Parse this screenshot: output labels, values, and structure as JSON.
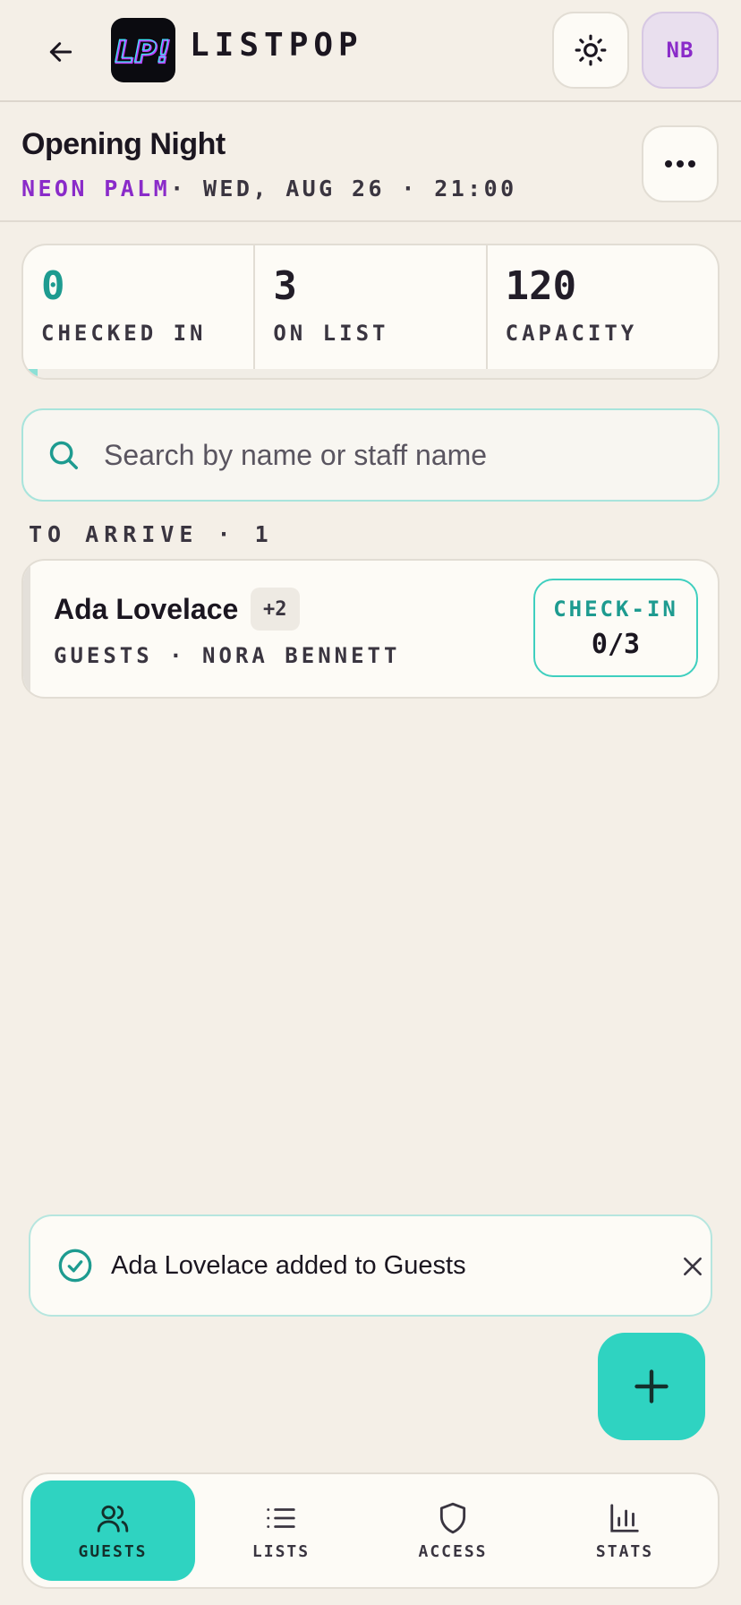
{
  "app": {
    "brand": "LISTPOP",
    "logo_text": "LP!",
    "avatar_initials": "NB"
  },
  "event": {
    "title": "Opening Night",
    "venue": "NEON PALM",
    "schedule": "· WED, AUG 26 · 21:00"
  },
  "stats": {
    "checked_in": {
      "value": "0",
      "label": "CHECKED IN"
    },
    "on_list": {
      "value": "3",
      "label": "ON LIST"
    },
    "capacity": {
      "value": "120",
      "label": "CAPACITY"
    },
    "progress_fraction": 0.0
  },
  "search": {
    "placeholder": "Search by name or staff name",
    "value": ""
  },
  "section": {
    "label": "TO ARRIVE · 1"
  },
  "guests": [
    {
      "name": "Ada Lovelace",
      "plus": "+2",
      "meta": "GUESTS · NORA BENNETT",
      "checkin_label": "CHECK-IN",
      "checkin_count": "0/3"
    }
  ],
  "toast": {
    "message": "Ada Lovelace added to Guests"
  },
  "nav": {
    "items": [
      {
        "label": "GUESTS",
        "icon": "users-icon",
        "active": true
      },
      {
        "label": "LISTS",
        "icon": "list-icon",
        "active": false
      },
      {
        "label": "ACCESS",
        "icon": "shield-icon",
        "active": false
      },
      {
        "label": "STATS",
        "icon": "bar-chart-icon",
        "active": false
      }
    ]
  },
  "colors": {
    "accent_teal": "#2fd3c1",
    "venue_purple": "#8a2bc9",
    "background": "#f4efe7"
  }
}
